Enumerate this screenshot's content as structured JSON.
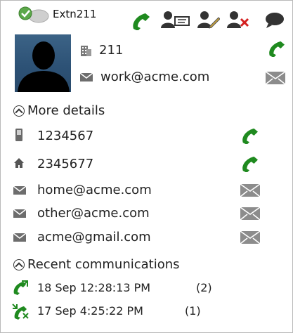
{
  "header": {
    "title": "Extn211",
    "status": "available",
    "colors": {
      "phone": "#1f8a1f",
      "remove": "#d42020",
      "dark": "#333333"
    }
  },
  "contact": {
    "extension": "211",
    "work_email": "work@acme.com"
  },
  "more_details": {
    "label": "More details",
    "mobile": "1234567",
    "home_phone": "2345677",
    "emails": [
      "home@acme.com",
      "other@acme.com",
      "acme@gmail.com"
    ]
  },
  "recent": {
    "label": "Recent communications",
    "items": [
      {
        "type": "outgoing-call",
        "text": "18 Sep 12:28:13 PM",
        "count": "(2)"
      },
      {
        "type": "missed-call",
        "text": "17 Sep 4:25:22 PM",
        "count": "(1)"
      }
    ]
  }
}
